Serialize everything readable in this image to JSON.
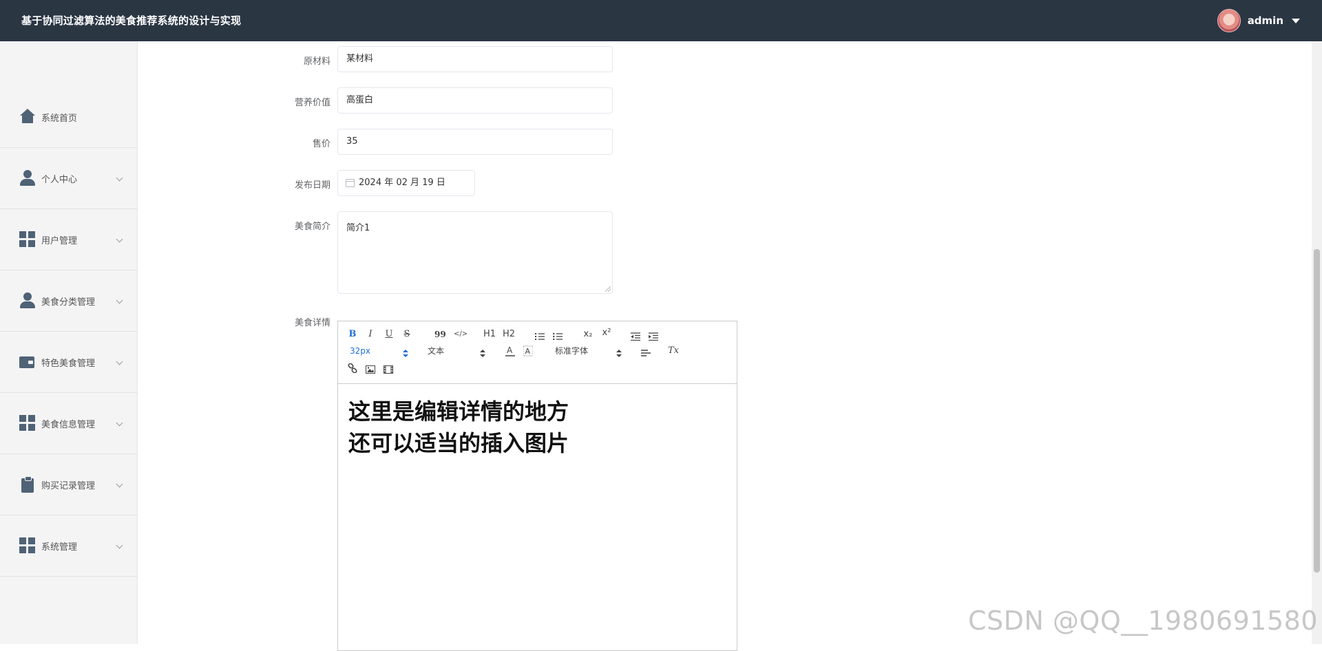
{
  "header": {
    "title": "基于协同过滤算法的美食推荐系统的设计与实现",
    "username": "admin"
  },
  "sidebar": {
    "items": [
      {
        "label": "系统首页",
        "icon": "home-icon"
      },
      {
        "label": "个人中心",
        "icon": "user-icon"
      },
      {
        "label": "用户管理",
        "icon": "grid-icon"
      },
      {
        "label": "美食分类管理",
        "icon": "user-icon"
      },
      {
        "label": "特色美食管理",
        "icon": "wallet-icon"
      },
      {
        "label": "美食信息管理",
        "icon": "grid-icon"
      },
      {
        "label": "购买记录管理",
        "icon": "clipboard-icon"
      },
      {
        "label": "系统管理",
        "icon": "grid-icon"
      }
    ]
  },
  "form": {
    "material_label": "原材料",
    "material_value": "某材料",
    "nutrition_label": "营养价值",
    "nutrition_value": "高蛋白",
    "price_label": "售价",
    "price_value": "35",
    "date_label": "发布日期",
    "date_value": "2024 年 02 月 19 日",
    "intro_label": "美食简介",
    "intro_value": "简介1",
    "detail_label": "美食详情"
  },
  "editor": {
    "toolbar": {
      "bold": "B",
      "italic": "I",
      "underline": "U",
      "strike": "S",
      "quote": "99",
      "code": "</>",
      "h1": "H1",
      "h2": "H2",
      "subscript": "x₂",
      "superscript": "x²",
      "size": "32px",
      "text_type": "文本",
      "font": "标准字体",
      "clear": "Tx"
    },
    "line1": "这里是编辑详情的地方",
    "line2": "还可以适当的插入图片"
  },
  "watermark": "CSDN @QQ__1980691580",
  "colors": {
    "header_bg": "#2b3643",
    "sidebar_bg": "#f4f4f5",
    "icon": "#4f6276",
    "accent_blue": "#1e6fd9"
  }
}
